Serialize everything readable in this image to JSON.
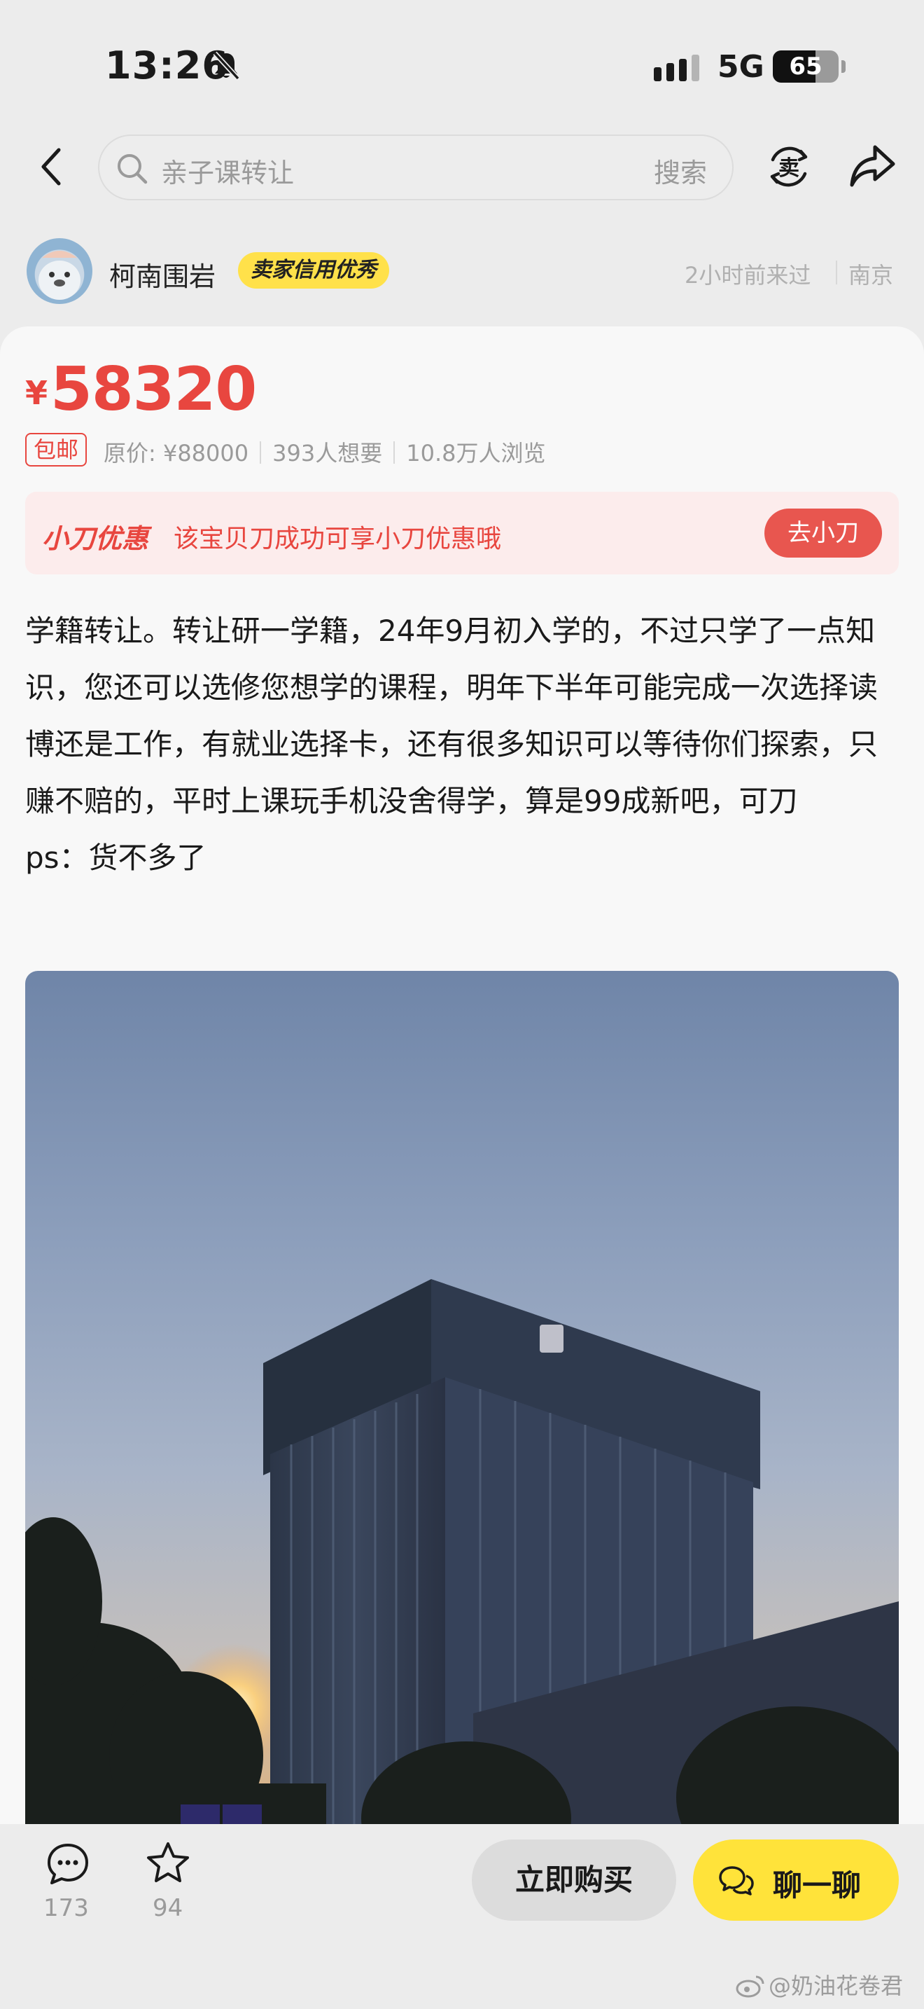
{
  "status_bar": {
    "time": "13:26",
    "network": "5G",
    "battery": "65",
    "battery_level": 0.65
  },
  "search": {
    "placeholder": "亲子课转让",
    "button_label": "搜索"
  },
  "nav": {
    "sell_icon_char": "卖"
  },
  "seller": {
    "name": "柯南围岩",
    "badge": "卖家信用优秀",
    "last_seen": "2小时前来过",
    "location": "南京"
  },
  "product": {
    "currency": "¥",
    "price": "58320",
    "shipping_tag": "包邮",
    "original_price": "原价: ¥88000",
    "wants": "393人想要",
    "views": "10.8万人浏览"
  },
  "promo": {
    "title": "小刀优惠",
    "text": "该宝贝刀成功可享小刀优惠哦",
    "button": "去小刀"
  },
  "description": {
    "line1": "学籍转让。转让研一学籍，24年9月初入学的，不过只学了一点知识，您还可以选修您想学的课程，明年下半年可能完成一次选择读博还是工作，有就业选择卡，还有很多知识可以等待你们探索，只赚不赔的，平时上课玩手机没舍得学，算是99成新吧，可刀",
    "line2": "ps：货不多了"
  },
  "bottom_bar": {
    "comment_count": "173",
    "favorite_count": "94",
    "buy_label": "立即购买",
    "chat_label": "聊一聊"
  },
  "watermark": "@奶油花卷君",
  "colors": {
    "price_red": "#e8463f",
    "badge_yellow": "#ffe14a",
    "chat_yellow": "#ffe33a",
    "promo_bg": "#fcecec"
  }
}
